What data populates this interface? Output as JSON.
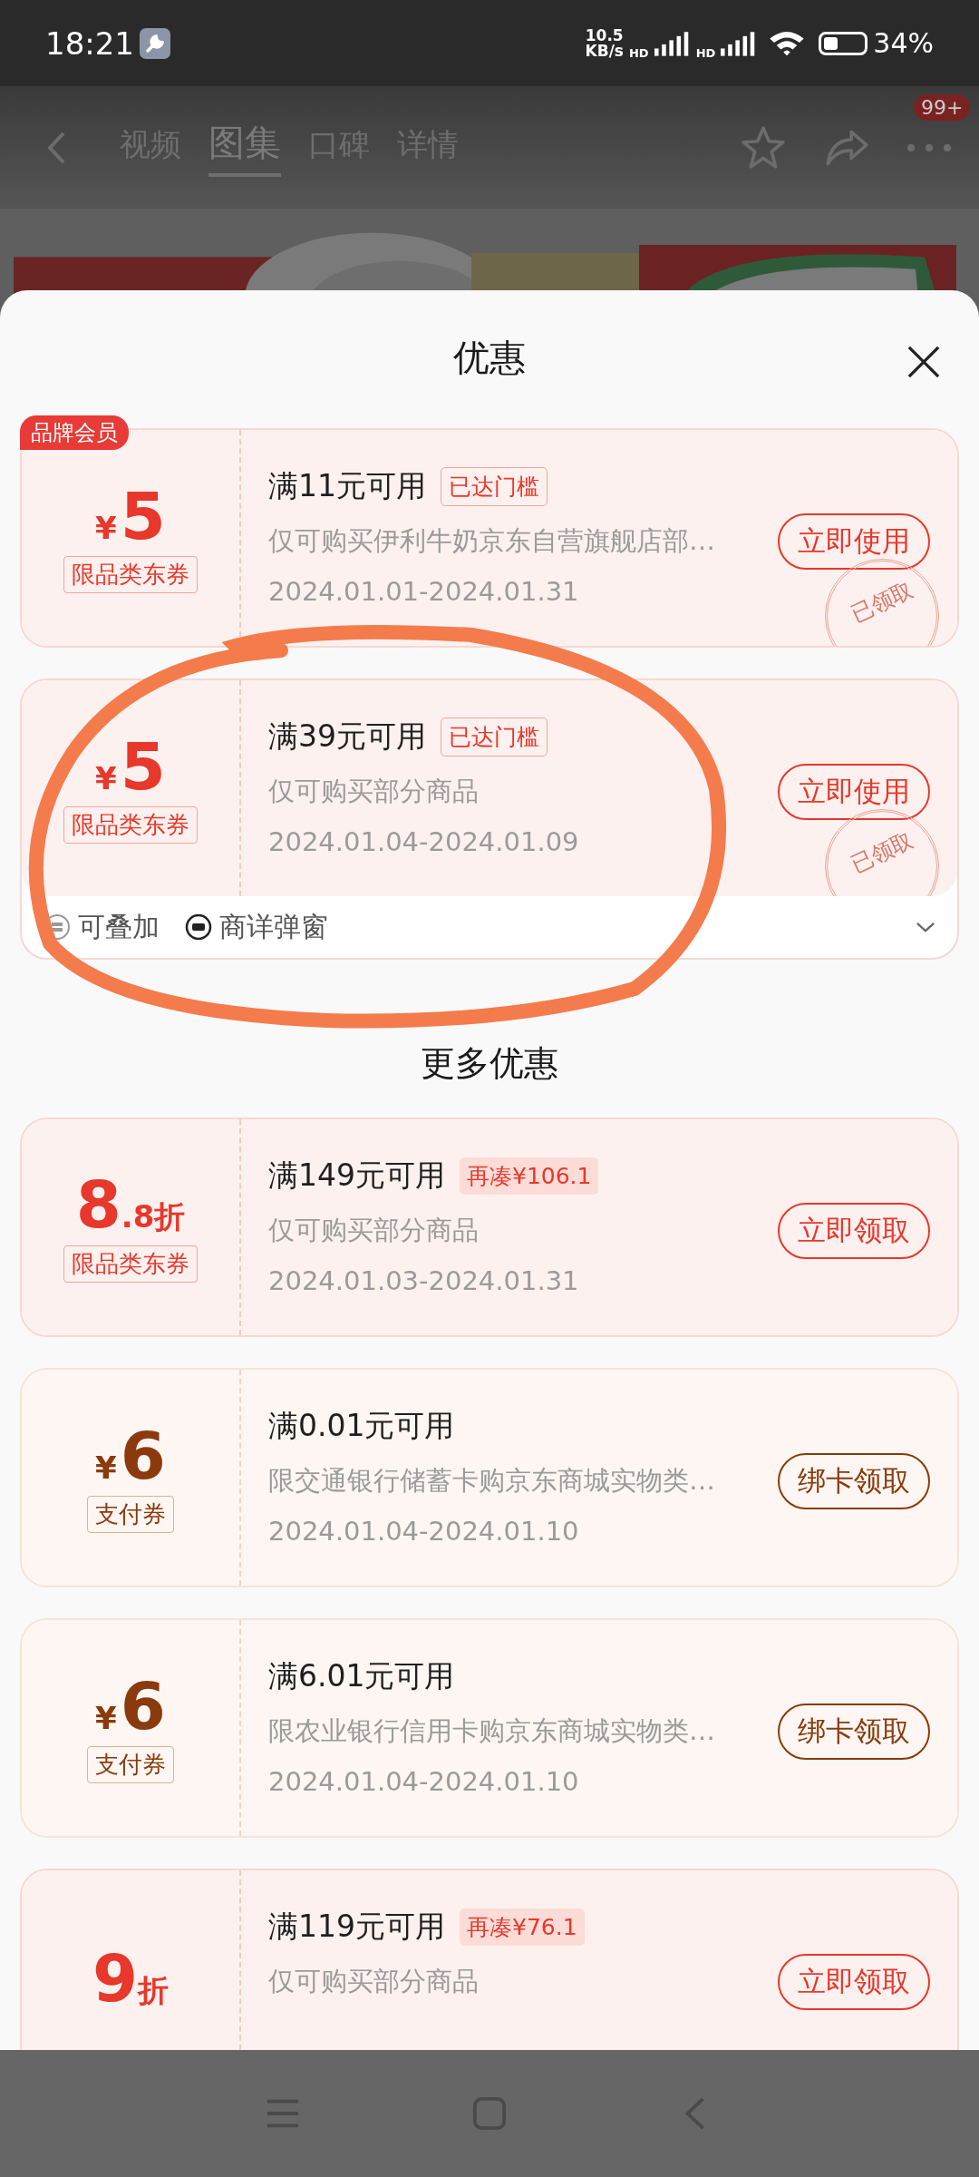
{
  "status_bar": {
    "time": "18:21",
    "net_speed": "10.5",
    "net_unit": "KB/s",
    "sim_labels": [
      "HD",
      "HD"
    ],
    "battery": "34%"
  },
  "nav": {
    "tabs": [
      {
        "label": "视频",
        "selected": false
      },
      {
        "label": "图集",
        "selected": true
      },
      {
        "label": "口碑",
        "selected": false
      },
      {
        "label": "详情",
        "selected": false
      }
    ],
    "badge": "99+"
  },
  "sheet": {
    "title": "优惠",
    "more_title": "更多优惠"
  },
  "coupons": [
    {
      "kind": "jd",
      "member_badge": "品牌会员",
      "prefix": "¥",
      "amount": "5",
      "type_tag": "限品类东券",
      "title": "满11元可用",
      "tag": {
        "kind": "reached",
        "text": "已达门槛"
      },
      "desc": "仅可购买伊利牛奶京东自营旗舰店部…",
      "date": "2024.01.01-2024.01.31",
      "button": "立即使用",
      "stamp": "已领取"
    },
    {
      "kind": "jd",
      "prefix": "¥",
      "amount": "5",
      "type_tag": "限品类东券",
      "title": "满39元可用",
      "tag": {
        "kind": "reached",
        "text": "已达门槛"
      },
      "desc": "仅可购买部分商品",
      "date": "2024.01.04-2024.01.09",
      "button": "立即使用",
      "stamp": "已领取",
      "features": [
        {
          "kind": "stack",
          "text": "可叠加"
        },
        {
          "kind": "popup",
          "text": "商详弹窗"
        }
      ]
    }
  ],
  "more_coupons": [
    {
      "kind": "jd",
      "amount": "8",
      "suffix": ".8折",
      "type_tag": "限品类东券",
      "title": "满149元可用",
      "tag": {
        "kind": "short",
        "text": "再凑¥106.1"
      },
      "desc": "仅可购买部分商品",
      "date": "2024.01.03-2024.01.31",
      "button": "立即领取"
    },
    {
      "kind": "pay",
      "prefix": "¥",
      "amount": "6",
      "type_tag": "支付券",
      "title": "满0.01元可用",
      "desc": "限交通银行储蓄卡购京东商城实物类…",
      "date": "2024.01.04-2024.01.10",
      "button": "绑卡领取"
    },
    {
      "kind": "pay",
      "prefix": "¥",
      "amount": "6",
      "type_tag": "支付券",
      "title": "满6.01元可用",
      "desc": "限农业银行信用卡购京东商城实物类…",
      "date": "2024.01.04-2024.01.10",
      "button": "绑卡领取"
    },
    {
      "kind": "jd",
      "amount": "9",
      "suffix": "折",
      "title": "满119元可用",
      "tag": {
        "kind": "short",
        "text": "再凑¥76.1"
      },
      "desc": "仅可购买部分商品",
      "button": "立即领取"
    }
  ]
}
